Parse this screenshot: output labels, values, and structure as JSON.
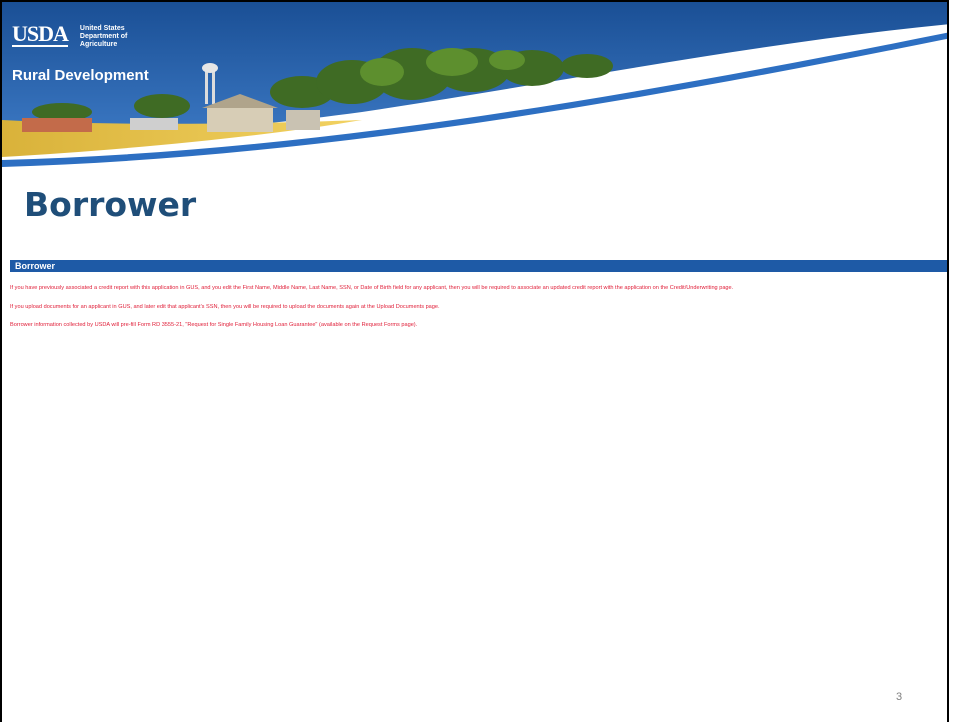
{
  "header": {
    "logo_text": "USDA",
    "department_lines": [
      "United States",
      "Department of",
      "Agriculture"
    ],
    "agency": "Rural Development"
  },
  "page": {
    "title": "Borrower",
    "section_header": "Borrower",
    "notices": [
      "If you have previously associated a credit report with this application in GUS, and you edit the First Name, Middle Name, Last Name, SSN, or Date of Birth field for any applicant, then you will be required to associate an updated credit report with the application on the Credit/Underwriting page.",
      "If you upload documents for an applicant in GUS, and later edit that applicant's SSN, then you will be required to upload the documents again at the Upload Documents page.",
      "Borrower information collected by USDA will pre-fill Form RD 3555-21, \"Request for Single Family Housing Loan Guarantee\" (available on the Request Forms page)."
    ],
    "slide_number": "3"
  },
  "colors": {
    "title": "#1f4e79",
    "section_bar": "#1e5aa6",
    "notice_text": "#e0203a",
    "banner_blue": "#1d5aa5"
  }
}
